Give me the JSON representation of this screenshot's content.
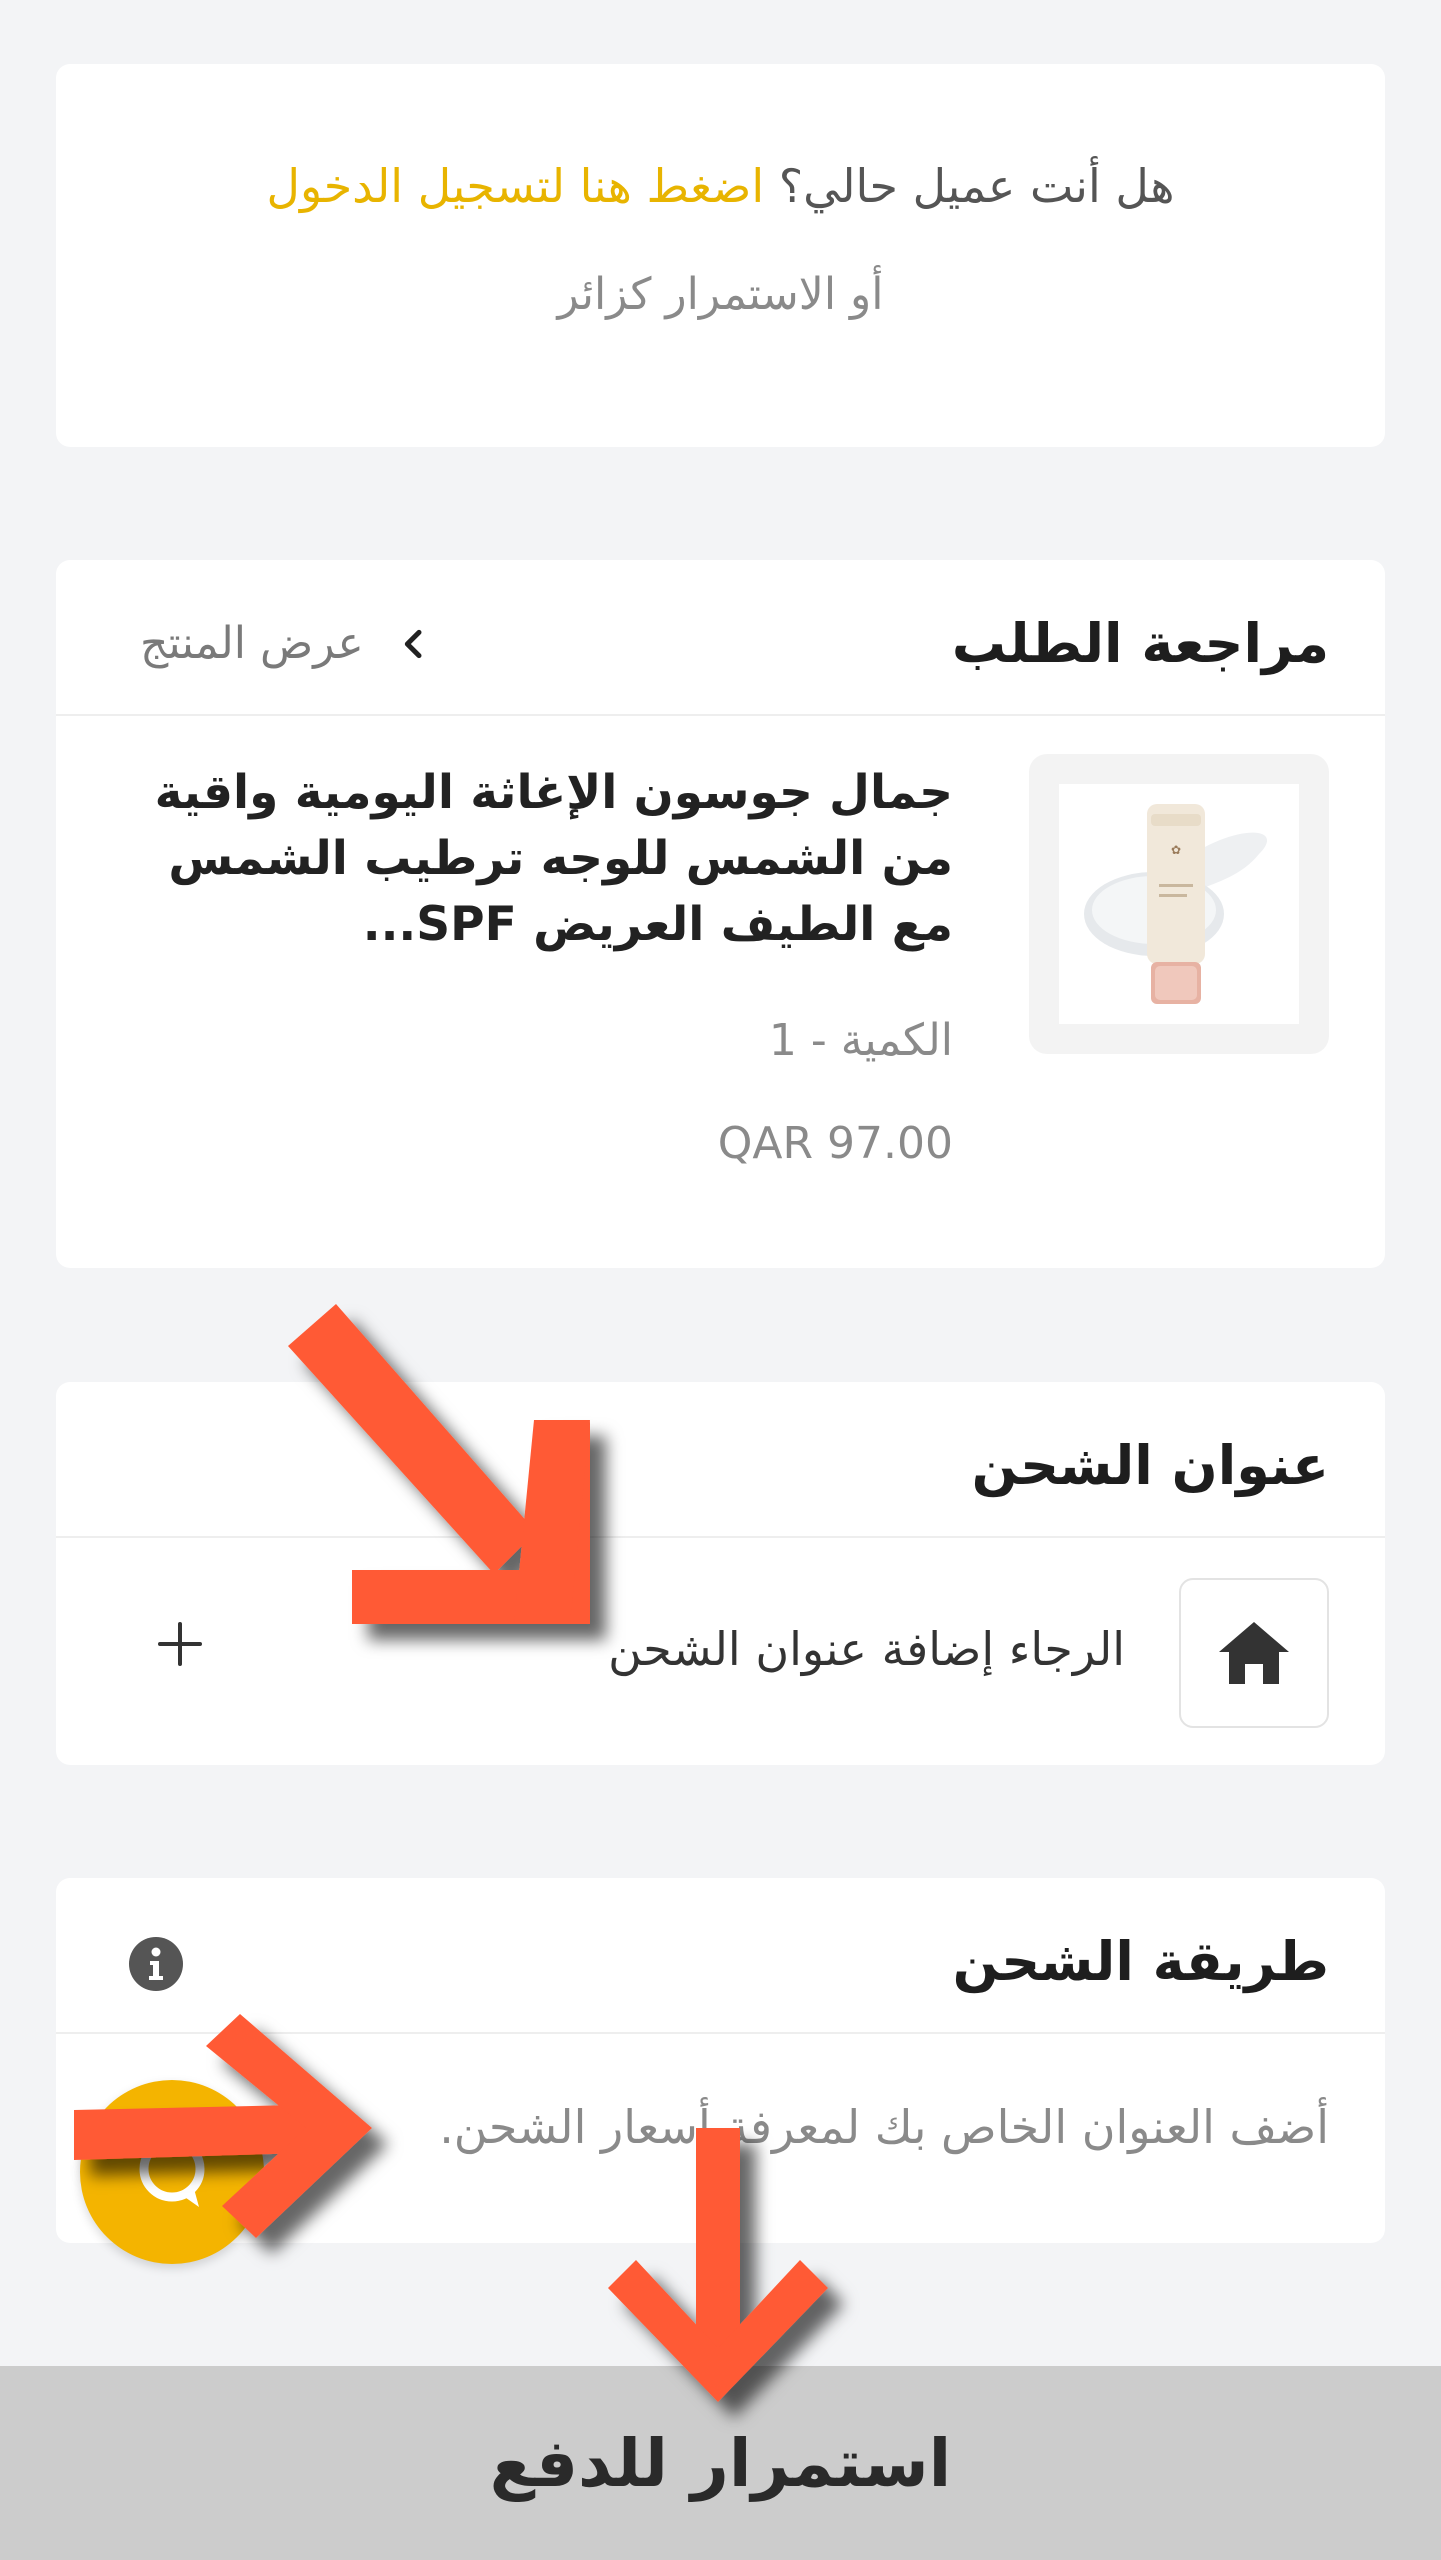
{
  "login": {
    "question": "هل أنت عميل حالي؟",
    "login_link": "اضغط هنا لتسجيل الدخول",
    "guest_text": "أو الاستمرار كزائر"
  },
  "order_review": {
    "title": "مراجعة الطلب",
    "view_product": "عرض المنتج",
    "product": {
      "name": "جمال جوسون الإغاثة اليومية واقية من الشمس للوجه ترطيب الشمس مع الطيف العريض SPF...",
      "quantity": "الكمية - 1",
      "price": "QAR 97.00"
    }
  },
  "shipping_address": {
    "title": "عنوان الشحن",
    "placeholder": "الرجاء إضافة عنوان الشحن",
    "home_icon": "home-icon",
    "add_icon": "plus-icon"
  },
  "shipping_method": {
    "title": "طريقة الشحن",
    "hint": "أضف العنوان الخاص بك لمعرفة أسعار الشحن.",
    "info_icon": "info-icon"
  },
  "chat": {
    "icon": "chat-bubble-icon"
  },
  "checkout": {
    "label": "استمرار للدفع"
  },
  "colors": {
    "accent": "#e8b400",
    "chat_fab": "#f4b400",
    "annotation_arrow": "#ff5a36",
    "checkout_bg": "#cccccc"
  }
}
